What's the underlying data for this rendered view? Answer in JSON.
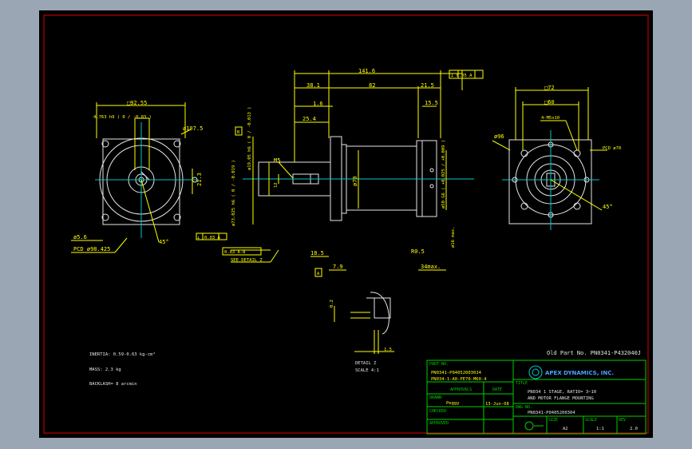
{
  "drawing": {
    "old_part_no": "Old Part No. PN0341-P432040J",
    "notes": {
      "inertia": "INERTIA: 0.59-0.63 kg-cm²",
      "mass": "MASS: 2.3 kg",
      "backlash": "BACKLASH= 8 arcmin"
    },
    "left_view": {
      "square": "□92.55",
      "keyway": "4.763 h9 ( 0 / -0.03 )",
      "bolt_hole": "ø107.5",
      "bolt_dia": "ø5.6",
      "pcd": "PCD ø98.425",
      "angle": "45°",
      "dim_213": "21.3"
    },
    "side_view": {
      "total": "141.6",
      "d381": "38.1",
      "d82": "82",
      "d215": "21.5",
      "d16": "1.6",
      "d254": "25.4",
      "d155": "15.5",
      "d185": "18.5",
      "d79": "7.9",
      "r05": "R0.5",
      "max34": "34max.",
      "shaft_dia": "ø19.05 h6 ( 0 / -0.013 )",
      "pilot_dia": "ø73.025 h6 ( 0 / -0.019 )",
      "d70": "ø70",
      "d50": "ø50 G6 ( +0.025 / +0.009 )",
      "m5": "M5",
      "d12": "12",
      "d16max": "ø16 max.",
      "see_detail": "SEE DETAIL Z",
      "datum_a": "A",
      "datum_b": "B",
      "fcf_perp": "⊥  0.05  A",
      "fcf_flat": "0.03  A",
      "fcf_run": "0.03  A-B",
      "fcf_run2": "0.02  A"
    },
    "right_view": {
      "sq72": "□72",
      "sq60": "□60",
      "m5x10": "4-M5x10",
      "d96": "ø96",
      "pcd70": "PCD ø70",
      "angle": "45°"
    },
    "detail_z": {
      "title": "DETAIL Z",
      "scale": "SCALE 4:1",
      "d02": "0.2",
      "d15": "1.5"
    },
    "title_block": {
      "part_no_label": "PART NO.",
      "part_no_1": "PN0341-P040520030J4",
      "part_no_2": "PN034-1-A0-PE70-M60-4",
      "approvals": "APPROVALS",
      "date": "DATE",
      "drawn_label": "DRAWN",
      "drawn_by": "Peggy",
      "drawn_date": "13-Jun-08",
      "checked": "CHECKED",
      "approved": "APPROVED",
      "company": "APEX DYNAMICS, INC.",
      "title_label": "TITLE",
      "title_1": "PN034 1 STAGE, RATIO= 3~10",
      "title_2": "AND MOTOR FLANGE MOUNTING",
      "dwg_no_label": "DWG NO.",
      "dwg_no": "PN0341-P0405200304",
      "size_label": "SIZE",
      "size": "A2",
      "scale_label": "SCALE",
      "scale": "1:1",
      "rev_label": "REV",
      "rev": "2.0"
    }
  }
}
